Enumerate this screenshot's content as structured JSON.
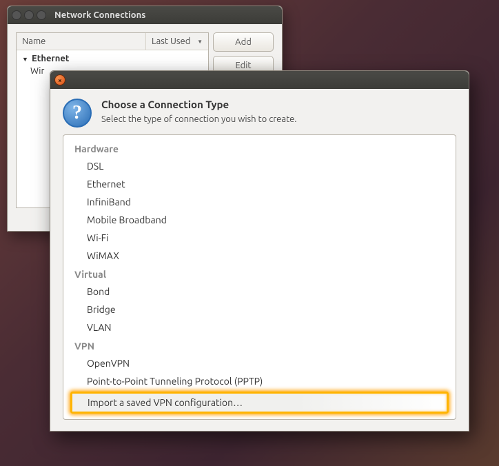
{
  "bgWindow": {
    "title": "Network Connections",
    "columns": {
      "name": "Name",
      "lastUsed": "Last Used"
    },
    "rows": {
      "group": "Ethernet",
      "item": "Wir"
    },
    "buttons": {
      "add": "Add",
      "edit": "Edit"
    }
  },
  "modal": {
    "title": "Choose a Connection Type",
    "subtitle": "Select the type of connection you wish to create.",
    "groups": {
      "hardware": {
        "label": "Hardware",
        "items": [
          "DSL",
          "Ethernet",
          "InfiniBand",
          "Mobile Broadband",
          "Wi-Fi",
          "WiMAX"
        ]
      },
      "virtual": {
        "label": "Virtual",
        "items": [
          "Bond",
          "Bridge",
          "VLAN"
        ]
      },
      "vpn": {
        "label": "VPN",
        "items": [
          "OpenVPN",
          "Point-to-Point Tunneling Protocol (PPTP)"
        ],
        "highlighted": "Import a saved VPN configuration…"
      }
    }
  }
}
